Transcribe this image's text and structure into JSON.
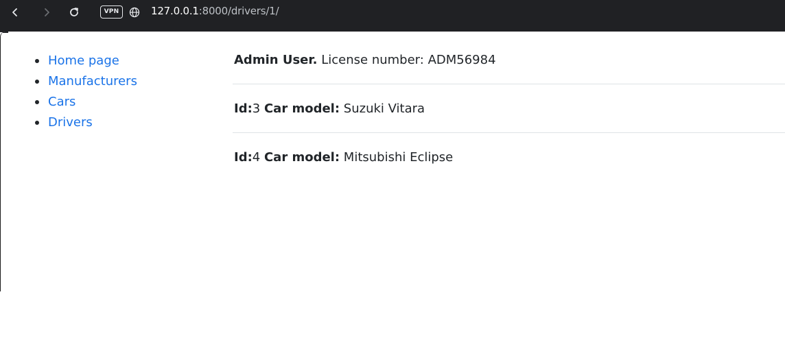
{
  "browser": {
    "vpn_label": "VPN",
    "url_host": "127.0.0.1",
    "url_rest": ":8000/drivers/1/"
  },
  "sidebar": {
    "items": [
      {
        "label": "Home page"
      },
      {
        "label": "Manufacturers"
      },
      {
        "label": "Cars"
      },
      {
        "label": "Drivers"
      }
    ]
  },
  "driver": {
    "name": "Admin User.",
    "license_label": "License number:",
    "license_number": "ADM56984"
  },
  "cars": [
    {
      "id_label": "Id:",
      "id": "3",
      "model_label": "Car model:",
      "model": "Suzuki Vitara"
    },
    {
      "id_label": "Id:",
      "id": "4",
      "model_label": "Car model:",
      "model": "Mitsubishi Eclipse"
    }
  ],
  "colors": {
    "link": "#1a73e8",
    "text": "#212529",
    "browser_bar": "#202124",
    "divider": "#dee2e6"
  }
}
